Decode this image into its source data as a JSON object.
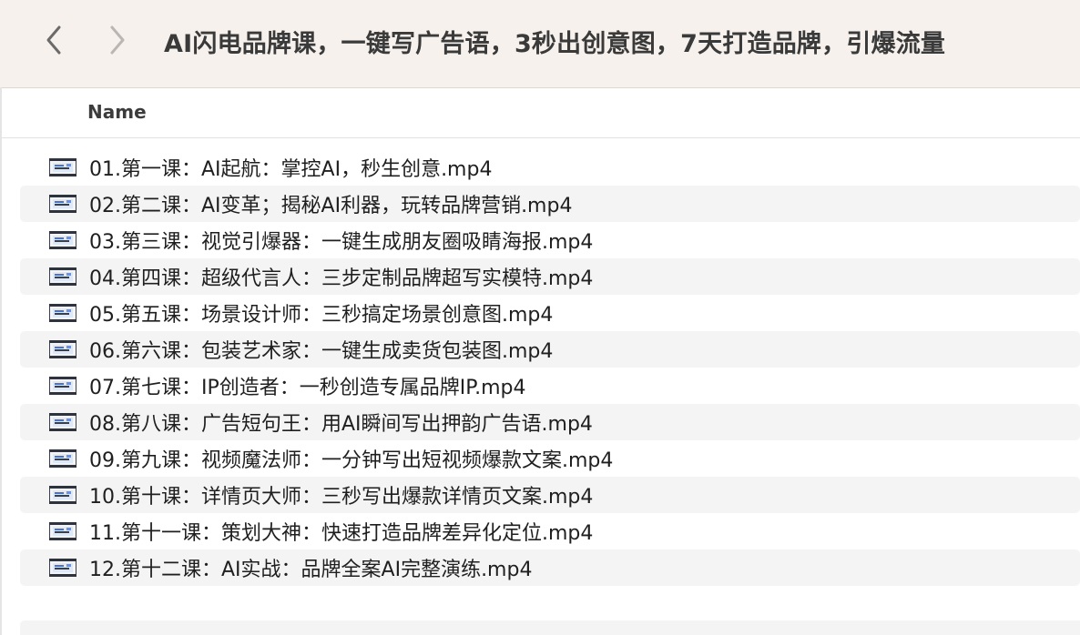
{
  "window": {
    "title": "AI闪电品牌课，一键写广告语，3秒出创意图，7天打造品牌，引爆流量"
  },
  "toolbar": {
    "back_icon": "chevron-left-icon",
    "forward_icon": "chevron-right-icon"
  },
  "list_header": {
    "name_column": "Name"
  },
  "files": [
    {
      "name": "01.第一课：AI起航：掌控AI，秒生创意.mp4",
      "icon": "video-file-icon"
    },
    {
      "name": "02.第二课：AI变革；揭秘AI利器，玩转品牌营销.mp4",
      "icon": "video-file-icon"
    },
    {
      "name": "03.第三课：视觉引爆器：一键生成朋友圈吸睛海报.mp4",
      "icon": "video-file-icon"
    },
    {
      "name": "04.第四课：超级代言人：三步定制品牌超写实模特.mp4",
      "icon": "video-file-icon"
    },
    {
      "name": "05.第五课：场景设计师：三秒搞定场景创意图.mp4",
      "icon": "video-file-icon"
    },
    {
      "name": "06.第六课：包装艺术家：一键生成卖货包装图.mp4",
      "icon": "video-file-icon"
    },
    {
      "name": "07.第七课：IP创造者：一秒创造专属品牌IP.mp4",
      "icon": "video-file-icon"
    },
    {
      "name": "08.第八课：广告短句王：用AI瞬间写出押韵广告语.mp4",
      "icon": "video-file-icon"
    },
    {
      "name": "09.第九课：视频魔法师：一分钟写出短视频爆款文案.mp4",
      "icon": "video-file-icon"
    },
    {
      "name": "10.第十课：详情页大师：三秒写出爆款详情页文案.mp4",
      "icon": "video-file-icon"
    },
    {
      "name": "11.第十一课：策划大神：快速打造品牌差异化定位.mp4",
      "icon": "video-file-icon"
    },
    {
      "name": "12.第十二课：AI实战：品牌全案AI完整演练.mp4",
      "icon": "video-file-icon"
    }
  ],
  "colors": {
    "toolbar_bg": "#f6f1ed",
    "alt_row": "#f4f4f5",
    "text": "#1f1f1f"
  }
}
